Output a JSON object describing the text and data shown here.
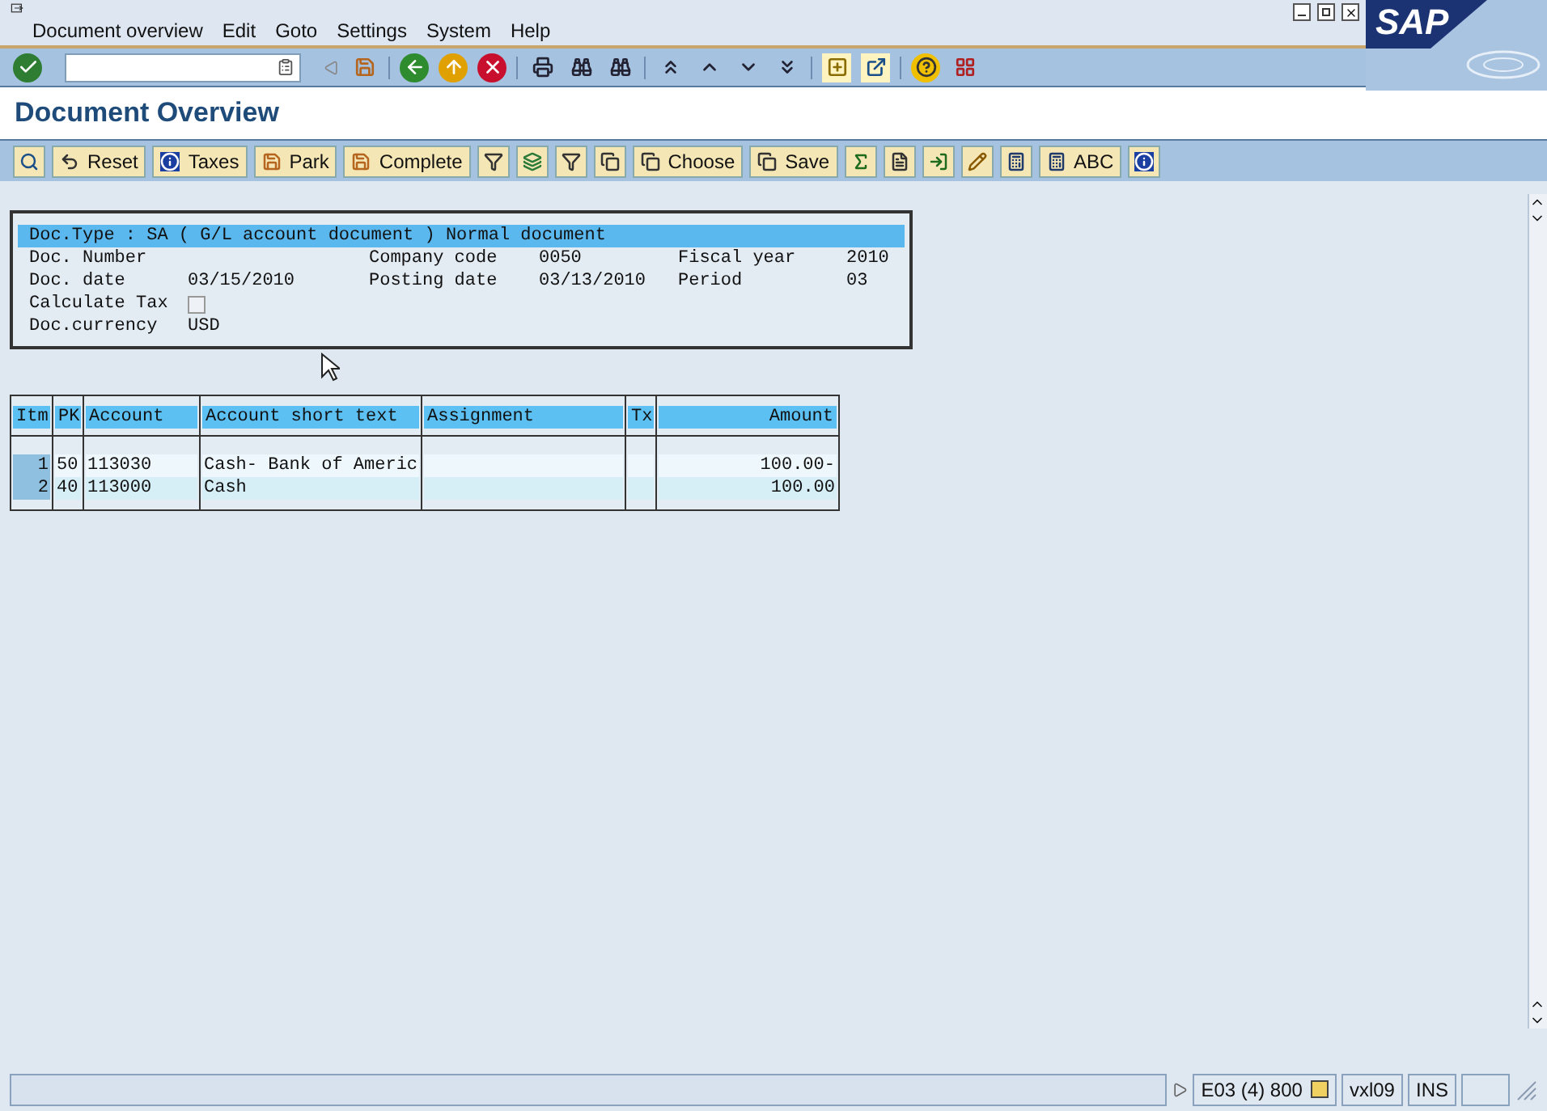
{
  "menu_bar": {
    "items": [
      "Document overview",
      "Edit",
      "Goto",
      "Settings",
      "System",
      "Help"
    ]
  },
  "logo": "SAP",
  "title": "Document Overview",
  "application_toolbar": [
    {
      "kind": "icon"
    },
    {
      "kind": "labeled",
      "label": "Reset"
    },
    {
      "kind": "labeled",
      "label": "Taxes"
    },
    {
      "kind": "labeled",
      "label": "Park"
    },
    {
      "kind": "labeled",
      "label": "Complete"
    },
    {
      "kind": "icon"
    },
    {
      "kind": "icon"
    },
    {
      "kind": "icon"
    },
    {
      "kind": "icon"
    },
    {
      "kind": "labeled",
      "label": "Choose"
    },
    {
      "kind": "labeled",
      "label": "Save"
    },
    {
      "kind": "icon"
    },
    {
      "kind": "icon"
    },
    {
      "kind": "icon"
    },
    {
      "kind": "icon"
    },
    {
      "kind": "icon"
    },
    {
      "kind": "labeled",
      "label": "ABC"
    },
    {
      "kind": "icon"
    }
  ],
  "header": {
    "doc_type_line": "Doc.Type : SA ( G/L account document ) Normal document",
    "fields": [
      {
        "label": "Doc. Number"
      },
      {
        "label": "Company code",
        "value": "0050"
      },
      {
        "label": "Fiscal year",
        "value": "2010"
      },
      {
        "label": "Doc. date",
        "value": "03/15/2010"
      },
      {
        "label": "Posting date",
        "value": "03/13/2010"
      },
      {
        "label": "Period",
        "value": "03"
      }
    ],
    "calculate_tax": {
      "label": "Calculate Tax",
      "checked": false
    },
    "currency": {
      "label": "Doc.currency",
      "value": "USD"
    }
  },
  "table": {
    "columns": [
      "Itm",
      "PK",
      "Account",
      "Account short text",
      "Assignment",
      "Tx",
      "Amount"
    ],
    "rows": [
      [
        "1",
        "50",
        "113030",
        "Cash- Bank of Americ",
        "",
        "",
        "100.00-"
      ],
      [
        "2",
        "40",
        "113000",
        "Cash",
        "",
        "",
        "100.00"
      ]
    ]
  },
  "status_bar": {
    "system": "E03 (4) 800",
    "server": "vxl09",
    "mode": "INS"
  }
}
